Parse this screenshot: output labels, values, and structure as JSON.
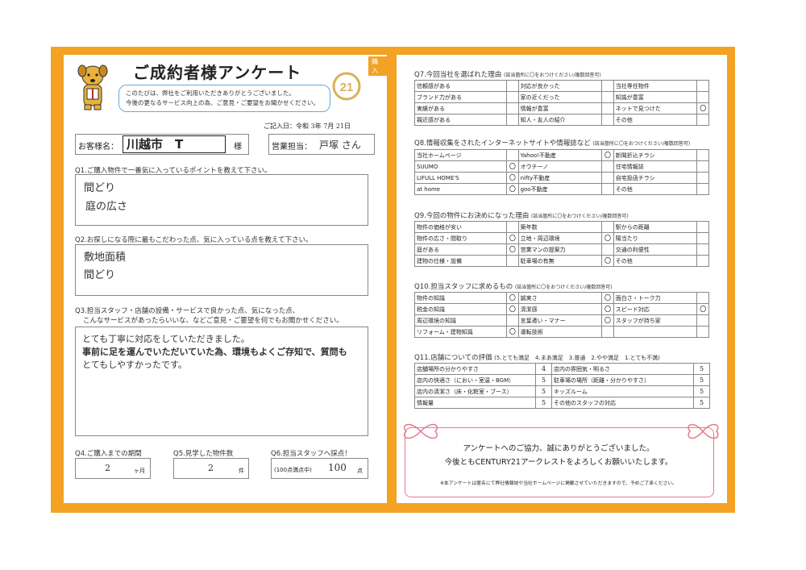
{
  "left": {
    "title": "ご成約者様アンケート",
    "tag": "購入",
    "greeting": [
      "このたびは、弊社をご利用いただきありがとうございました。",
      "今後の更なるサービス向上の為、ご意見・ご要望をお聞かせください。"
    ],
    "date_label": "ご記入日：令和",
    "date_year": "3",
    "date_year_unit": "年",
    "date_month": "7",
    "date_month_unit": "月",
    "date_day": "21",
    "date_day_unit": "日",
    "customer_label": "お客様名：",
    "customer_name": "川越市　T",
    "customer_suffix": "様",
    "staff_label": "営業担当：",
    "staff_name": "戸塚 さん",
    "q1": "Q1.ご購入物件で一番気に入っているポイントを教えて下さい。",
    "q1_answers": [
      "間どり",
      "庭の広さ"
    ],
    "q2": "Q2.お探しになる際に最もこだわった点、気に入っている点を教えて下さい。",
    "q2_answers": [
      "敷地面積",
      "間どり"
    ],
    "q3_line1": "Q3.担当スタッフ・店舗の設備・サービスで良かった点、気になった点、",
    "q3_line2": "こんなサービスがあったらいいな、などご意見・ご要望を何でもお聞かせください。",
    "q3_answers": [
      "とても丁寧に対応をしていただきました。",
      "事前に足を運んでいただいていた為、環境もよくご存知で、質問も",
      "とてもしやすかったです。"
    ],
    "q4": "Q4.ご購入までの期間",
    "q4_value": "2",
    "q4_unit": "ヶ月",
    "q5": "Q5.見学した物件数",
    "q5_value": "2",
    "q5_unit": "件",
    "q6": "Q6.担当スタッフへ採点！",
    "q6_prefix": "(100点満点中)",
    "q6_value": "100",
    "q6_unit": "点"
  },
  "right": {
    "q7": {
      "title": "Q7.今回当社を選ばれた理由",
      "note": "(該当箇所に〇をおつけください/複数回答可)",
      "rows": [
        [
          "信頼感がある",
          "",
          "対応が良かった",
          "",
          "当社専任物件",
          ""
        ],
        [
          "ブランド力がある",
          "",
          "家の近くだった",
          "",
          "知識が豊富",
          ""
        ],
        [
          "実績がある",
          "",
          "情報が豊富",
          "",
          "ネットで見つけた",
          "〇"
        ],
        [
          "親近感がある",
          "",
          "知人・友人の紹介",
          "",
          "その他",
          ""
        ]
      ]
    },
    "q8": {
      "title": "Q8.情報収集をされたインターネットサイトや情報誌など",
      "note": "(該当箇所に〇をおつけください/複数回答可)",
      "rows": [
        [
          "当社ホームページ",
          "",
          "Yahoo!不動産",
          "〇",
          "新聞折込チラシ",
          ""
        ],
        [
          "SUUMO",
          "〇",
          "オウチーノ",
          "",
          "住宅情報誌",
          ""
        ],
        [
          "LIFULL HOME'S",
          "〇",
          "nifty不動産",
          "",
          "自宅投函チラシ",
          ""
        ],
        [
          "at home",
          "〇",
          "goo不動産",
          "",
          "その他",
          ""
        ]
      ]
    },
    "q9": {
      "title": "Q9.今回の物件にお決めになった理由",
      "note": "(該当箇所に〇をおつけください/複数回答可)",
      "rows": [
        [
          "物件の価格が安い",
          "",
          "築年数",
          "",
          "駅からの距離",
          ""
        ],
        [
          "物件の広さ・間取り",
          "〇",
          "立地・周辺環境",
          "〇",
          "陽当たり",
          ""
        ],
        [
          "庭がある",
          "〇",
          "営業マンの提案力",
          "",
          "交通の利便性",
          ""
        ],
        [
          "建物の仕様・設備",
          "",
          "駐車場の有無",
          "〇",
          "その他",
          ""
        ]
      ]
    },
    "q10": {
      "title": "Q10.担当スタッフに求めるもの",
      "note": "(該当箇所に〇をおつけください/複数回答可)",
      "rows": [
        [
          "物件の知識",
          "〇",
          "誠実さ",
          "〇",
          "面白さ・トーク力",
          ""
        ],
        [
          "税金の知識",
          "〇",
          "清潔感",
          "〇",
          "スピード対応",
          "〇"
        ],
        [
          "周辺環境の知識",
          "",
          "言葉遣い・マナー",
          "〇",
          "スタッフが持ち家",
          ""
        ],
        [
          "リフォーム・建物知識",
          "〇",
          "運転技術",
          "",
          "",
          ""
        ]
      ]
    },
    "q11": {
      "title": "Q11.店舗についての評価",
      "scale": "(5.とても満足　4.まあ満足　3.普通　2.やや満足　1.とても不満)",
      "rows": [
        [
          "店舗場所の分かりやすさ",
          "4",
          "店内の雰囲気・明るさ",
          "5"
        ],
        [
          "店内の快適さ（におい・室温・BGM）",
          "5",
          "駐車場の場所（距離・分かりやすさ）",
          "5"
        ],
        [
          "店内の清潔さ（床・化粧室・ブース）",
          "5",
          "キッズルーム",
          "5"
        ],
        [
          "情報量",
          "5",
          "その他のスタッフの対応",
          "5"
        ]
      ]
    },
    "thanks1": "アンケートへのご協力、誠にありがとうございました。",
    "thanks2": "今後ともCENTURY21アークレストをよろしくお願いいたします。",
    "footnote": "※本アンケートは匿名にて弊社情報誌や当社ホームページに掲載させていただきますので、予めご了承ください。"
  },
  "colors": {
    "frame": "#f3a224",
    "bubble_border": "#6aa8d8",
    "ribbon": "#e47a8f"
  },
  "icons": [
    "dog-mascot-icon",
    "century21-logo-icon"
  ]
}
